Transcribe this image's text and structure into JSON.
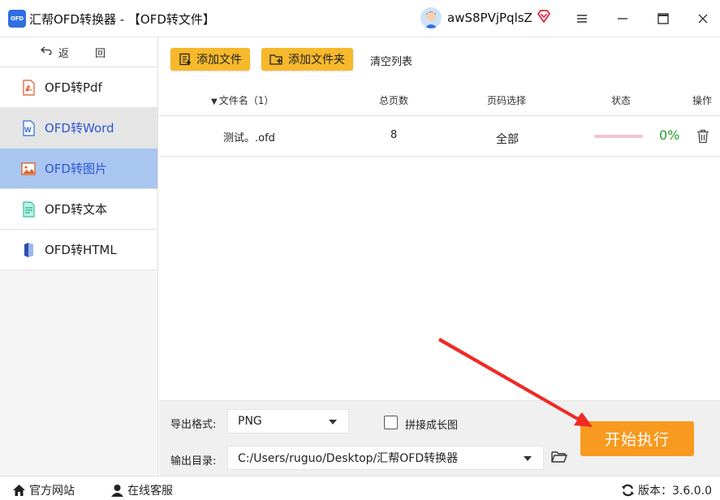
{
  "window": {
    "logo_text": "OFD",
    "title": "汇帮OFD转换器 - 【OFD转文件】",
    "username": "awS8PVjPqlsZ",
    "accent_color": "#2f6fe0"
  },
  "sidebar": {
    "back_label": "返 回",
    "back_icon": "back-arrow-icon",
    "items": [
      {
        "label": "OFD转Pdf",
        "icon": "pdf-icon",
        "state": "normal"
      },
      {
        "label": "OFD转Word",
        "icon": "word-icon",
        "state": "hover"
      },
      {
        "label": "OFD转图片",
        "icon": "image-icon",
        "state": "active"
      },
      {
        "label": "OFD转文本",
        "icon": "text-icon",
        "state": "normal"
      },
      {
        "label": "OFD转HTML",
        "icon": "html-icon",
        "state": "normal"
      }
    ],
    "active_color": "#a9c6f1"
  },
  "toolbar": {
    "add_file": "添加文件",
    "add_folder": "添加文件夹",
    "clear_list": "清空列表",
    "button_color": "#f6b92b"
  },
  "table": {
    "columns": [
      "文件名（1）",
      "总页数",
      "页码选择",
      "状态",
      "操作"
    ],
    "rows": [
      {
        "filename": "测试。.ofd",
        "pages": "8",
        "page_select": "全部",
        "progress": 0,
        "progress_text": "0%"
      }
    ]
  },
  "bottom": {
    "format_label": "导出格式:",
    "format_value": "PNG",
    "merge_label": "拼接成长图",
    "merge_checked": false,
    "output_label": "输出目录:",
    "output_value": "C:/Users/ruguo/Desktop/汇帮OFD转换器",
    "start_label": "开始执行",
    "start_color": "#f79a1f"
  },
  "statusbar": {
    "website": "官方网站",
    "support": "在线客服",
    "version": "版本：3.6.0.0"
  }
}
